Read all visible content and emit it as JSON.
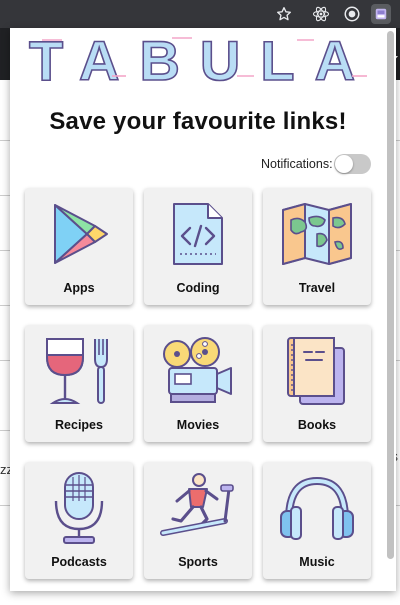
{
  "app": {
    "logo_text": "TABULA",
    "headline": "Save your favourite links!",
    "notifications_label": "Notifications:",
    "notifications_enabled": false
  },
  "behind_page": {
    "left_fragment": "zz",
    "right_fragment": "S"
  },
  "extensions": [
    "star-icon",
    "react-icon",
    "target-icon",
    "tabula-extension-icon"
  ],
  "categories": [
    {
      "label": "Apps",
      "icon": "play-store-icon"
    },
    {
      "label": "Coding",
      "icon": "code-file-icon"
    },
    {
      "label": "Travel",
      "icon": "map-icon"
    },
    {
      "label": "Recipes",
      "icon": "wine-fork-icon"
    },
    {
      "label": "Movies",
      "icon": "film-projector-icon"
    },
    {
      "label": "Books",
      "icon": "books-icon"
    },
    {
      "label": "Podcasts",
      "icon": "microphone-icon"
    },
    {
      "label": "Sports",
      "icon": "treadmill-runner-icon"
    },
    {
      "label": "Music",
      "icon": "headphones-icon"
    }
  ],
  "colors": {
    "logo_blue": "#a8d4f2",
    "logo_pink": "#f3a6c8",
    "outline": "#5b4f8c",
    "card_bg": "#f1f1f1"
  }
}
